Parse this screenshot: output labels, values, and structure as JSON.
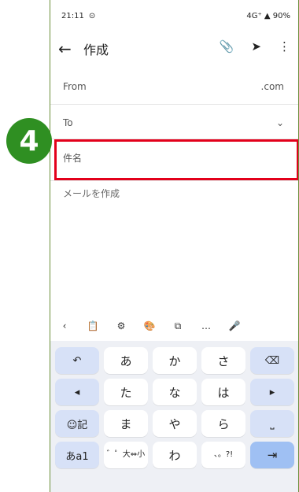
{
  "status": {
    "time": "21:11",
    "right": "4G⁺ ▲ 90%"
  },
  "appbar": {
    "back_icon": "←",
    "title": "作成",
    "attach_icon": "📎",
    "send_icon": "➤",
    "more_icon": "⋮"
  },
  "fields": {
    "from_label": "From",
    "from_value": ".com",
    "to_label": "To",
    "to_chevron": "⌄",
    "subject_label": "件名"
  },
  "body": {
    "placeholder": "メールを作成"
  },
  "badge": "4",
  "keyboard_toolbar": [
    "‹",
    "📋",
    "⚙",
    "🎨",
    "⧉",
    "…",
    "🎤"
  ],
  "keyboard": {
    "rows": [
      [
        "↶",
        "あ",
        "か",
        "さ",
        "⌫"
      ],
      [
        "◂",
        "た",
        "な",
        "は",
        "▸"
      ],
      [
        "☺記",
        "ま",
        "や",
        "ら",
        "⎵"
      ],
      [
        "あa1",
        "゛゜大⇔小",
        "わ",
        "、。?!",
        "⇥"
      ]
    ]
  }
}
